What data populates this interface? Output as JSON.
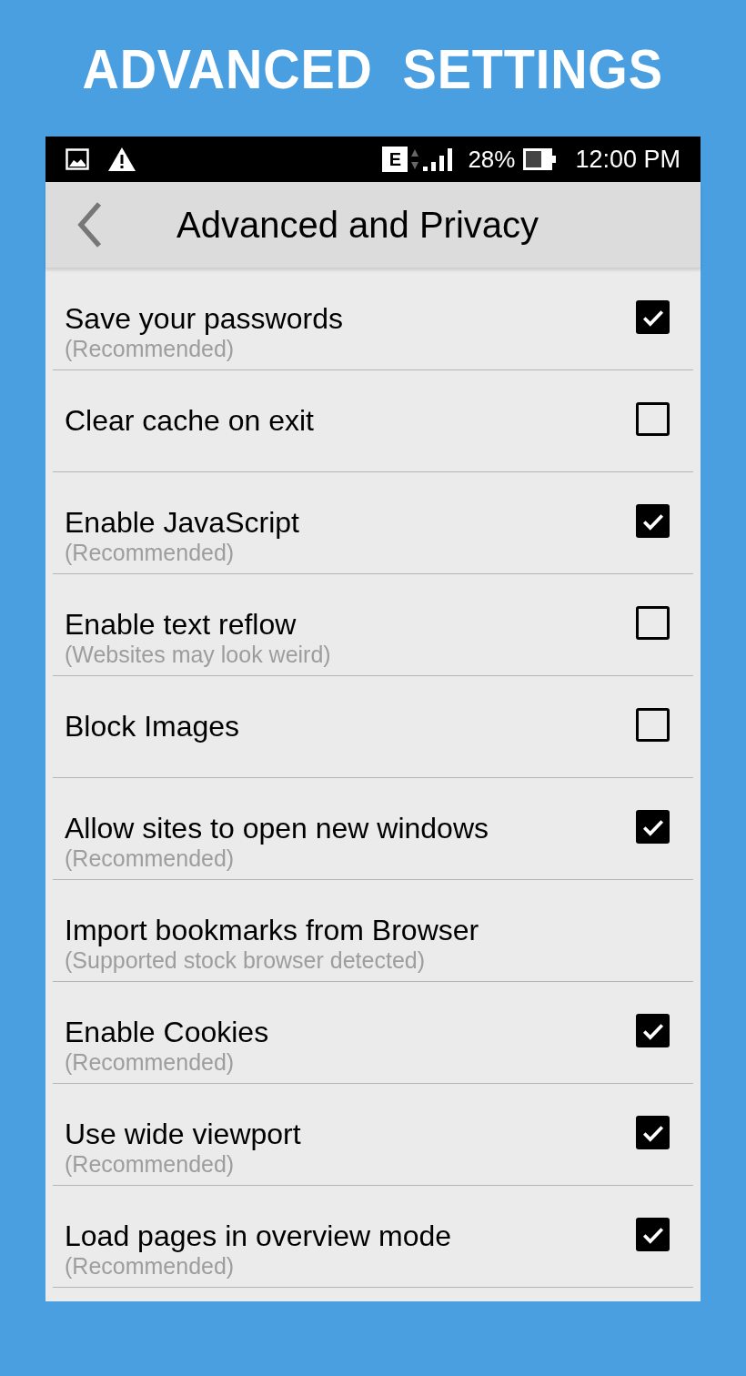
{
  "banner": {
    "title": "ADVANCED  SETTINGS"
  },
  "status_bar": {
    "network": "E",
    "battery": "28%",
    "time": "12:00 PM"
  },
  "header": {
    "title": "Advanced and Privacy"
  },
  "settings": [
    {
      "kind": "checkbox",
      "label": "Save your passwords",
      "note": "(Recommended)",
      "checked": true
    },
    {
      "kind": "checkbox",
      "label": "Clear cache on exit",
      "checked": false
    },
    {
      "kind": "checkbox",
      "label": "Enable JavaScript",
      "note": "(Recommended)",
      "checked": true
    },
    {
      "kind": "checkbox",
      "label": "Enable text reflow",
      "note": "(Websites may look weird)",
      "checked": false
    },
    {
      "kind": "checkbox",
      "label": "Block Images",
      "checked": false
    },
    {
      "kind": "checkbox",
      "label": "Allow sites to open new windows",
      "note": "(Recommended)",
      "checked": true
    },
    {
      "kind": "action",
      "label": "Import bookmarks from Browser",
      "note": "(Supported stock browser detected)"
    },
    {
      "kind": "checkbox",
      "label": "Enable Cookies",
      "note": "(Recommended)",
      "checked": true
    },
    {
      "kind": "checkbox",
      "label": "Use wide viewport",
      "note": "(Recommended)",
      "checked": true
    },
    {
      "kind": "checkbox",
      "label": "Load pages in overview mode",
      "note": "(Recommended)",
      "checked": true
    }
  ]
}
